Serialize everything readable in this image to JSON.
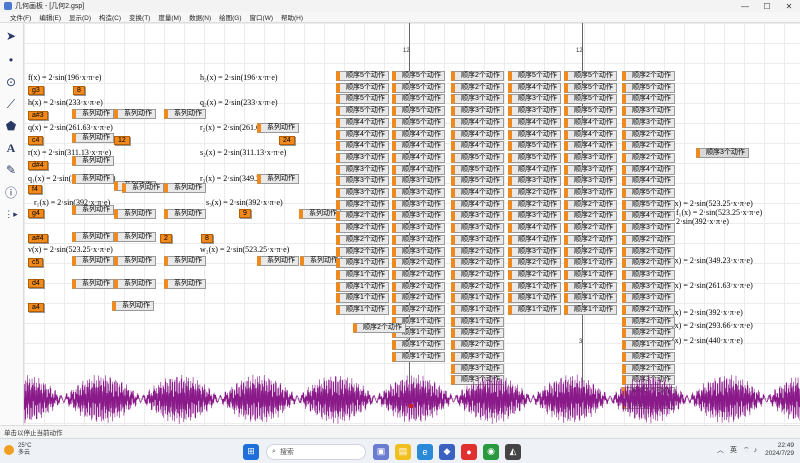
{
  "window": {
    "title": "几何画板 - [几何2.gsp]",
    "controls": [
      "—",
      "☐",
      "✕"
    ]
  },
  "menu": [
    "文件(F)",
    "编辑(E)",
    "显示(D)",
    "构造(C)",
    "变换(T)",
    "度量(M)",
    "数据(N)",
    "绘图(G)",
    "窗口(W)",
    "帮助(H)"
  ],
  "tools": [
    {
      "icon": "arrow-select-icon",
      "glyph": "➤"
    },
    {
      "icon": "point-icon",
      "glyph": "•"
    },
    {
      "icon": "compass-circle-icon",
      "glyph": "⊙"
    },
    {
      "icon": "straightedge-icon",
      "glyph": "⟋"
    },
    {
      "icon": "polygon-icon",
      "glyph": "⬟"
    },
    {
      "icon": "text-icon",
      "glyph": "A"
    },
    {
      "icon": "marker-icon",
      "glyph": "✎"
    },
    {
      "icon": "information-icon",
      "glyph": "ⓘ"
    },
    {
      "icon": "custom-tool-icon",
      "glyph": "⋮▸"
    }
  ],
  "y_axis_labels": [
    "12",
    "10",
    "8",
    "6",
    "4",
    "3",
    "2"
  ],
  "functions": [
    "f(x) = 2·sin(196·x·π·e)",
    "g3",
    "8",
    "h(x) = 2·sin(233·x·π·e)",
    "a#3",
    "q(x) = 2·sin(261.63·x·π·e)",
    "c4",
    "12",
    "r(x) = 2·sin(311.13·x·π·e)",
    "d#4",
    "q₁(x) = 2·sin(349.23·x·π·e)",
    "f4",
    "r₁(x) = 2·sin(392·x·π·e)",
    "g4",
    "a#4",
    "2",
    "8",
    "v(x) = 2·sin(523.25·x·π·e)",
    "c5",
    "d4",
    "a4",
    "h₂(x) = 2·sin(196·x·π·e)",
    "q₂(x) = 2·sin(233·x·π·e)",
    "r₂(x) = 2·sin(261.63·x·π·e)",
    "24",
    "s₂(x) = 2·sin(311.13·x·π·e)",
    "r₃(x) = 2·sin(349.23·x·π·e)",
    "s₃(x) = 2·sin(392·x·π·e)",
    "9",
    "w₂(x) = 2·sin(523.25·x·π·e)"
  ],
  "right_functions": [
    "(x) = 2·sin(523.25·x·π·e)",
    "f₁(x) = 2·sin(523.25·x·π·e)",
    "2·sin(392·x·π·e)",
    "(x) = 2·sin(349.23·x·π·e)",
    "(x) = 2·sin(261.63·x·π·e)",
    "(x) = 2·sin(392·x·π·e)",
    "(x) = 2·sin(293.66·x·π·e)",
    "(x) = 2·sin(440·x·π·e)"
  ],
  "buttons": {
    "series": "系列动作",
    "order1": "顺序1个动作",
    "order2": "顺序2个动作",
    "order3": "顺序3个动作",
    "order4": "顺序4个动作",
    "order5": "顺序5个动作"
  },
  "status": "单击以停止当前动作",
  "taskbar": {
    "temp": "25°C",
    "weather": "多云",
    "search_placeholder": "搜索",
    "lang": "英",
    "time": "22:49",
    "date": "2024/7/29"
  },
  "colors": {
    "accent": "#f08a1c",
    "wave": "#8a1a8a"
  }
}
